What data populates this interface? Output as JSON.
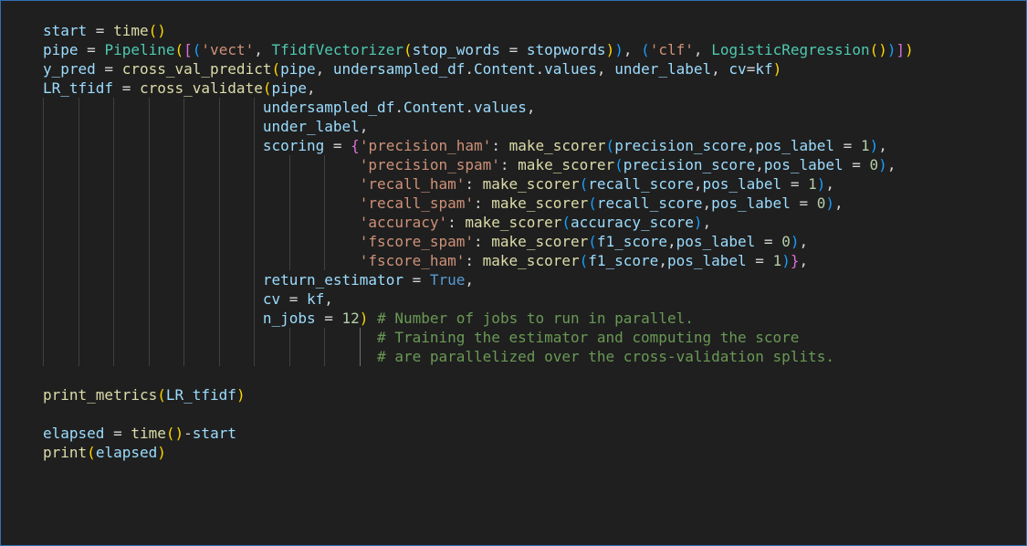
{
  "code_lines": [
    "start = time()",
    "pipe = Pipeline([('vect', TfidfVectorizer(stop_words = stopwords)), ('clf', LogisticRegression())])",
    "y_pred = cross_val_predict(pipe, undersampled_df.Content.values, under_label, cv=kf)",
    "LR_tfidf = cross_validate(pipe,",
    "                         undersampled_df.Content.values,",
    "                         under_label,",
    "                         scoring = {'precision_ham': make_scorer(precision_score,pos_label = 1),",
    "                                    'precision_spam': make_scorer(precision_score,pos_label = 0),",
    "                                    'recall_ham': make_scorer(recall_score,pos_label = 1),",
    "                                    'recall_spam': make_scorer(recall_score,pos_label = 0),",
    "                                    'accuracy': make_scorer(accuracy_score),",
    "                                    'fscore_spam': make_scorer(f1_score,pos_label = 0),",
    "                                    'fscore_ham': make_scorer(f1_score,pos_label = 1)},",
    "                         return_estimator = True,",
    "                         cv = kf,",
    "                         n_jobs = 12) # Number of jobs to run in parallel.",
    "                                      # Training the estimator and computing the score",
    "                                      # are parallelized over the cross-validation splits.",
    "",
    "print_metrics(LR_tfidf)",
    "",
    "elapsed = time()-start",
    "print(elapsed)"
  ],
  "syntax_colors": {
    "variable": "#9cdcfe",
    "function": "#dcdcaa",
    "class": "#4ec9b0",
    "string": "#ce9178",
    "number": "#b5cea8",
    "constant": "#569cd6",
    "comment": "#6a9955",
    "bracket_1": "#ffd700",
    "bracket_2": "#da70d6",
    "bracket_3": "#179fff",
    "background": "#1f1f1f",
    "focus_border": "#2f6fb5"
  }
}
